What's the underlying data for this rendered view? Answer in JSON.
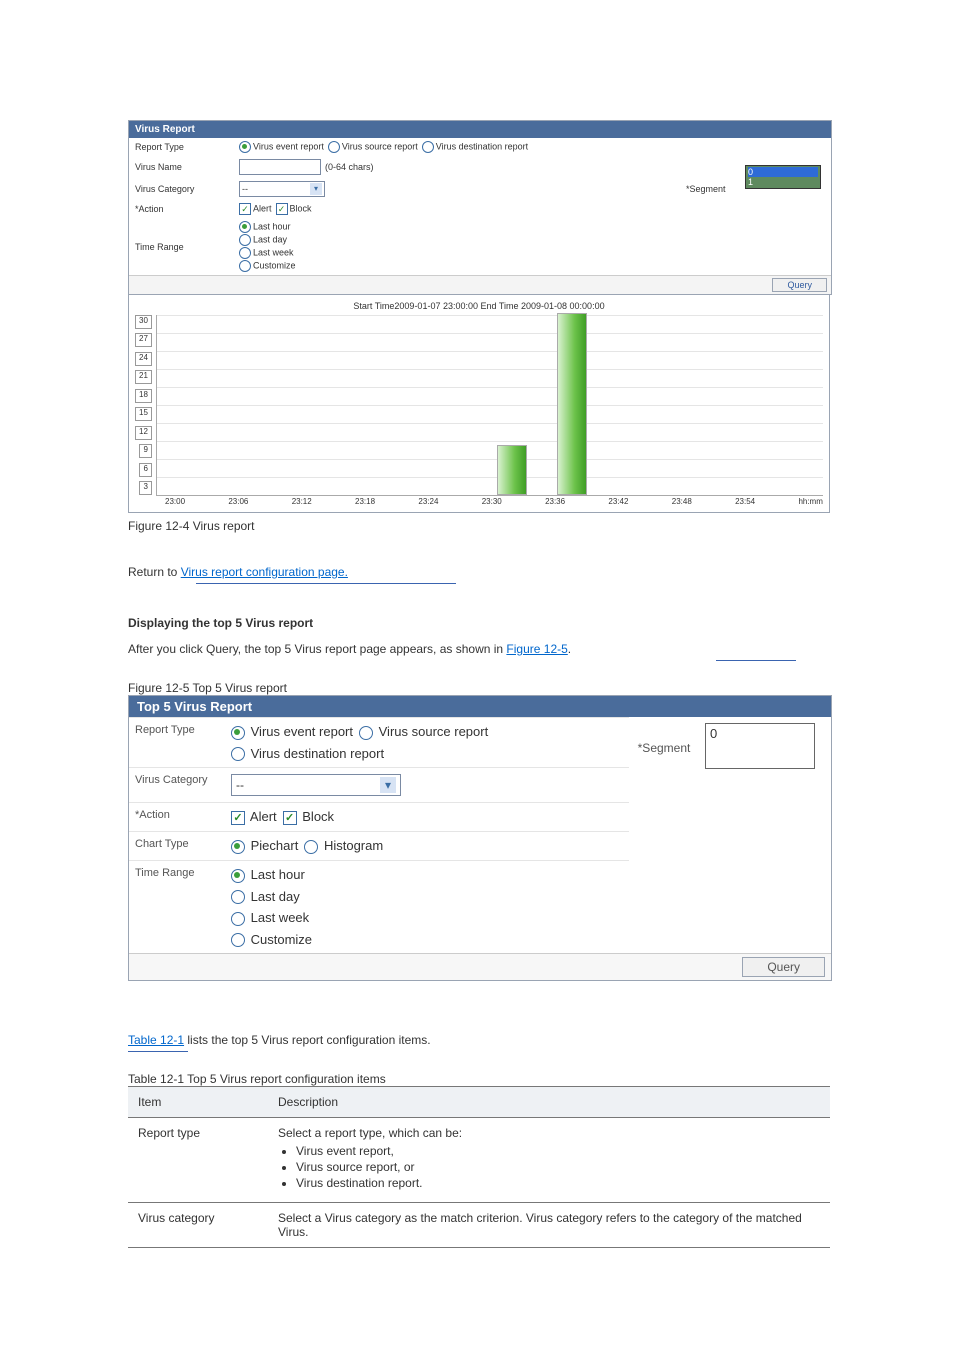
{
  "panel1": {
    "title": "Virus Report",
    "rows": {
      "report_type": {
        "label": "Report Type",
        "options": [
          "Virus event report",
          "Virus source report",
          "Virus destination report"
        ],
        "selected": 0
      },
      "virus_name": {
        "label": "Virus Name",
        "hint": "(0-64 chars)"
      },
      "virus_category": {
        "label": "Virus Category",
        "value": "--"
      },
      "action": {
        "label": "*Action",
        "options": [
          "Alert",
          "Block"
        ]
      },
      "time_range": {
        "label": "Time Range",
        "options": [
          "Last hour",
          "Last day",
          "Last week",
          "Customize"
        ],
        "selected": 0
      },
      "segment": {
        "label": "*Segment",
        "options": [
          "0",
          "1"
        ],
        "selected": 0
      }
    },
    "query_btn": "Query"
  },
  "chart_data": {
    "type": "bar",
    "title": "Start Time2009-01-07 23:00:00 End Time 2009-01-08 00:00:00",
    "ylim": [
      0,
      30
    ],
    "yticks": [
      30,
      27,
      24,
      21,
      18,
      15,
      12,
      9,
      6,
      3
    ],
    "categories": [
      "23:00",
      "23:06",
      "23:12",
      "23:18",
      "23:24",
      "23:30",
      "23:36",
      "23:42",
      "23:48",
      "23:54"
    ],
    "values": [
      0,
      0,
      0,
      0,
      0,
      0,
      8,
      30,
      0,
      0
    ],
    "xunit": "hh:mm"
  },
  "interlude1": {
    "caption": "Figure 12-4 Virus report",
    "line1": "Return to ",
    "link1": "Virus report configuration page.",
    "displaying_heading": "Displaying the top 5 Virus report",
    "figure5_line": "After you click Query, the top 5 Virus report page appears, as shown in ",
    "figure5_link": "Figure 12-5",
    "figure5_caption": "Figure 12-5 Top 5 Virus report"
  },
  "panel2": {
    "title": "Top 5 Virus Report",
    "rows": {
      "report_type": {
        "label": "Report Type",
        "options": [
          "Virus event report",
          "Virus source report",
          "Virus destination report"
        ],
        "selected": 0
      },
      "virus_category": {
        "label": "Virus Category",
        "value": "--"
      },
      "action": {
        "label": "*Action",
        "options": [
          "Alert",
          "Block"
        ]
      },
      "chart_type": {
        "label": "Chart Type",
        "options": [
          "Piechart",
          "Histogram"
        ],
        "selected": 0
      },
      "time_range": {
        "label": "Time Range",
        "options": [
          "Last hour",
          "Last day",
          "Last week",
          "Customize"
        ],
        "selected": 0
      },
      "segment": {
        "label": "*Segment",
        "value": "0"
      }
    },
    "query_btn": "Query"
  },
  "interlude2": {
    "link": "Table 12-1",
    "after": " lists the top 5 Virus report configuration items.",
    "table_caption": "Table 12-1 Top 5 Virus report configuration items"
  },
  "table121": {
    "headers": [
      "Item",
      "Description"
    ],
    "rows": [
      {
        "item": "Report type",
        "desc_intro": "Select a report type, which can be:",
        "bullets": [
          "Virus event report,",
          "Virus source report, or",
          "Virus destination report."
        ]
      },
      {
        "item": "Virus category",
        "desc": "Select a Virus category as the match criterion. Virus category refers to the category of the matched Virus."
      }
    ]
  }
}
